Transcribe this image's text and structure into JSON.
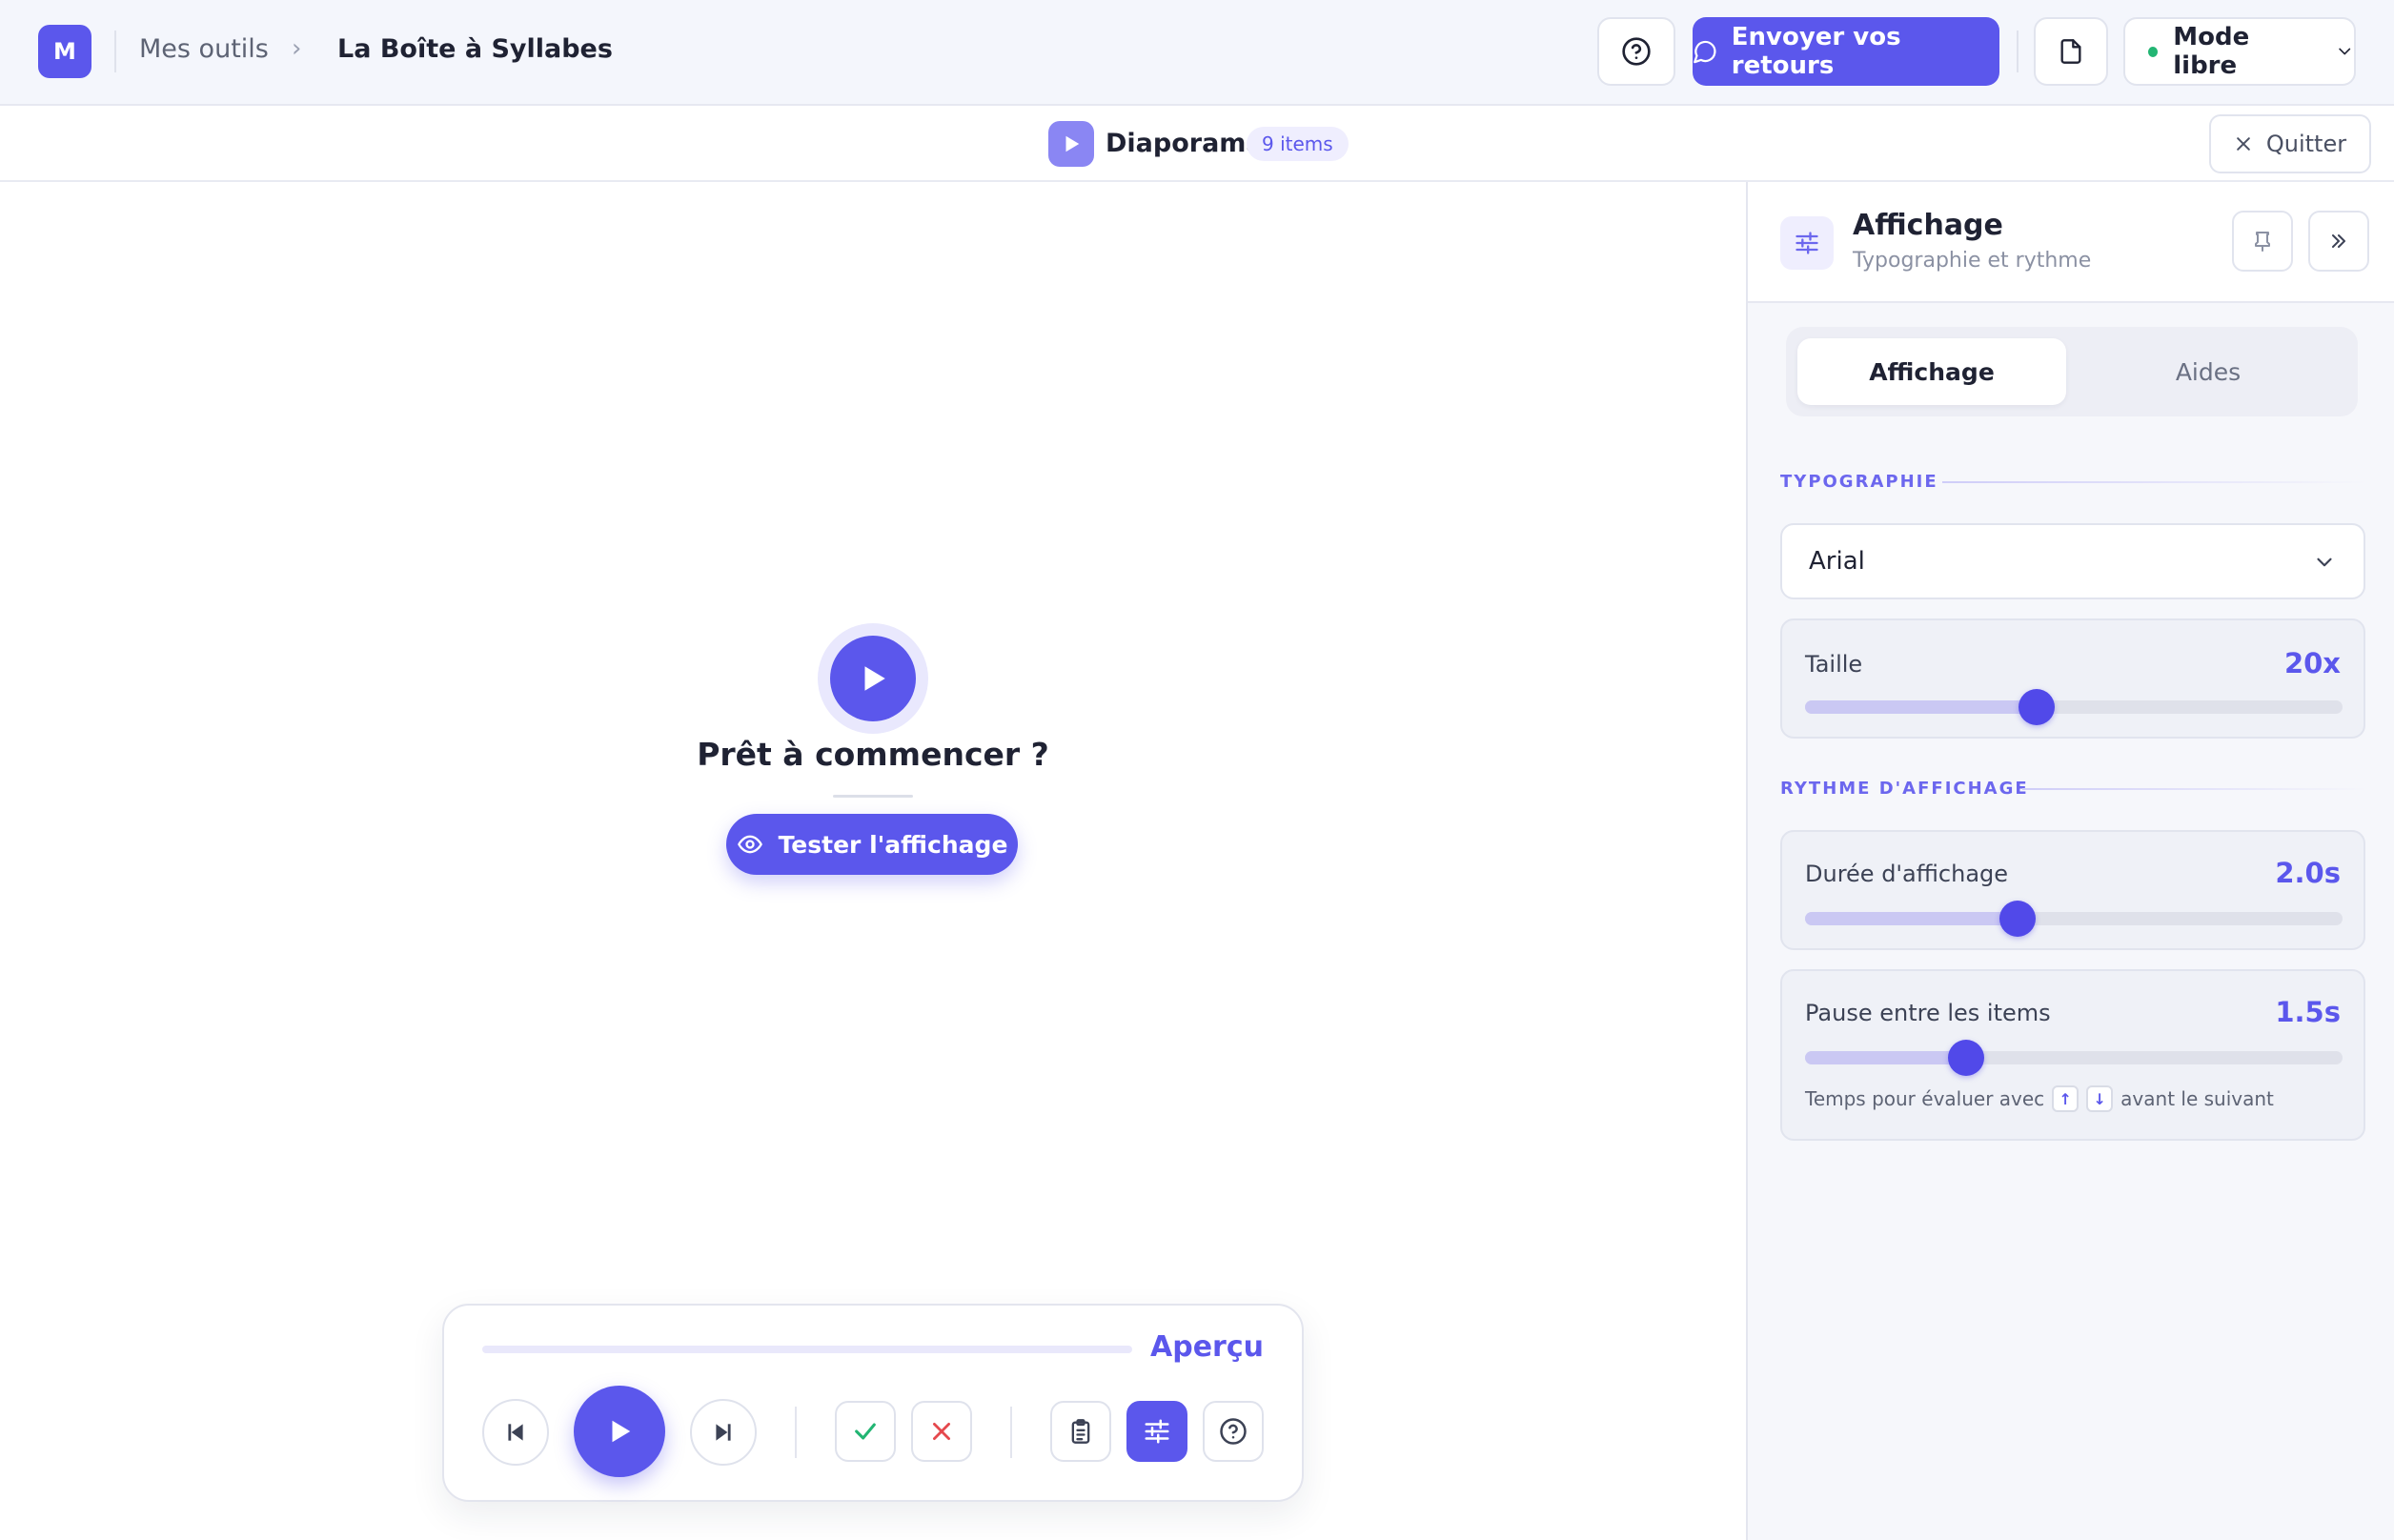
{
  "header": {
    "logo_letter": "M",
    "breadcrumb": {
      "parent": "Mes outils",
      "separator": "›",
      "current": "La Boîte à Syllabes"
    },
    "send_feedback_label": "Envoyer vos retours",
    "mode_label": "Mode libre",
    "mode_status_color": "#22b573"
  },
  "subheader": {
    "title": "Diaporama",
    "items_badge": "9 items",
    "quit_label": "Quitter"
  },
  "stage": {
    "ready_text": "Prêt à commencer ?",
    "test_button_label": "Tester l'affichage"
  },
  "player": {
    "label": "Aperçu",
    "progress": 0
  },
  "panel": {
    "title": "Affichage",
    "subtitle": "Typographie et rythme",
    "tabs": [
      {
        "label": "Affichage",
        "active": true
      },
      {
        "label": "Aides",
        "active": false
      }
    ],
    "typography": {
      "section_label": "TYPOGRAPHIE",
      "font_value": "Arial",
      "size": {
        "label": "Taille",
        "value_text": "20x",
        "fraction": 0.43
      }
    },
    "rhythm": {
      "section_label": "RYTHME D'AFFICHAGE",
      "duration": {
        "label": "Durée d'affichage",
        "value_text": "2.0s",
        "fraction": 0.395
      },
      "pause": {
        "label": "Pause entre les items",
        "value_text": "1.5s",
        "fraction": 0.3,
        "hint_before": "Temps pour évaluer avec",
        "key_up": "↑",
        "key_down": "↓",
        "hint_after": "avant le suivant"
      }
    }
  },
  "colors": {
    "accent": "#5b57ec",
    "correct": "#22b573",
    "incorrect": "#e5484d"
  }
}
